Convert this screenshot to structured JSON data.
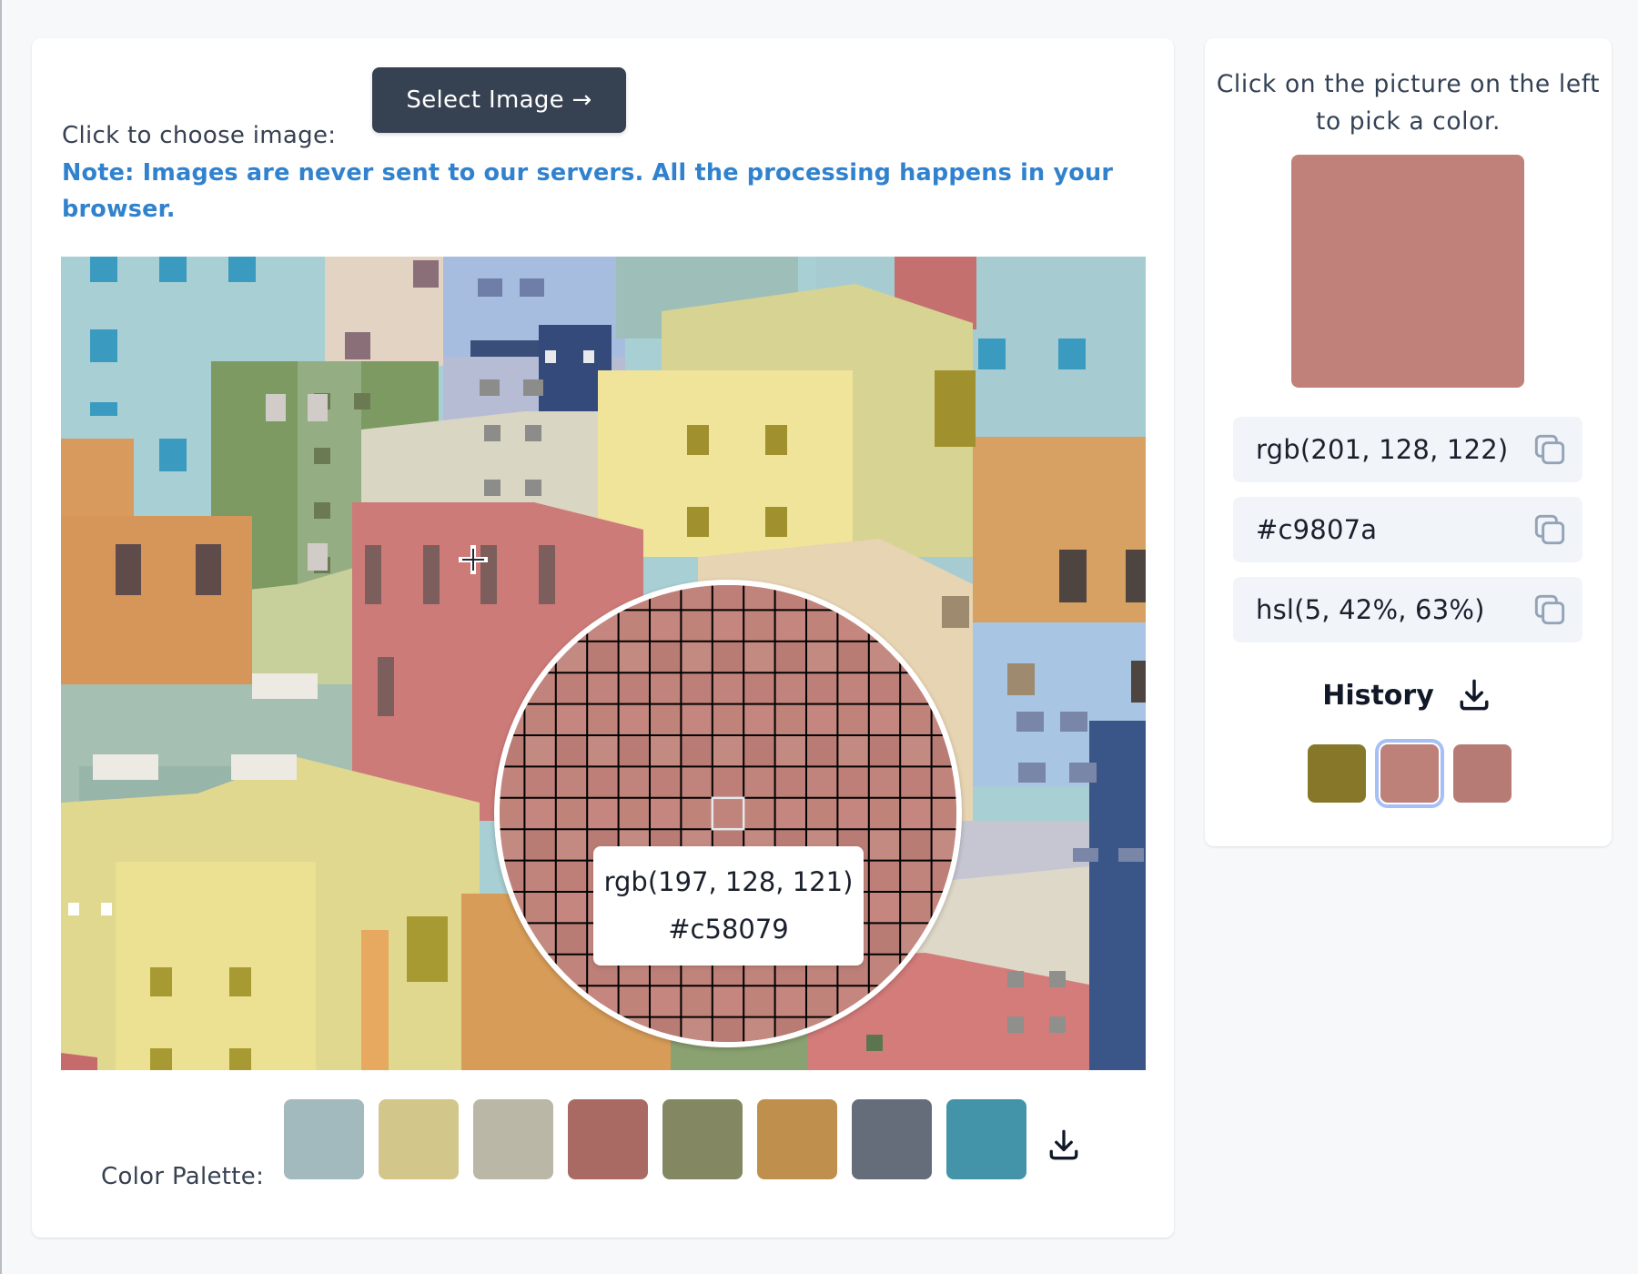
{
  "upload": {
    "label": "Click to choose image:",
    "button_label": "Select Image →",
    "note": "Note: Images are never sent to our servers. All the processing happens in your browser."
  },
  "magnifier": {
    "rgb": "rgb(197, 128, 121)",
    "hex": "#c58079",
    "fill": "#c1847c"
  },
  "palette": {
    "label": "Color Palette:",
    "colors": [
      "#a2b9bd",
      "#d3c68a",
      "#bbb7a6",
      "#a96a64",
      "#838862",
      "#bf904d",
      "#666d7a",
      "#4393a9"
    ],
    "download_icon": "download-icon"
  },
  "picker": {
    "instruction": "Click on the picture on the left to pick a color.",
    "selected_color": "#c1817b",
    "rgb": "rgb(201, 128, 122)",
    "hex": "#c9807a",
    "hsl": "hsl(5, 42%, 63%)",
    "copy_icon": "copy-icon"
  },
  "history": {
    "title": "History",
    "colors": [
      "#877829",
      "#bd817a",
      "#b77b75"
    ],
    "selected_index": 1
  }
}
